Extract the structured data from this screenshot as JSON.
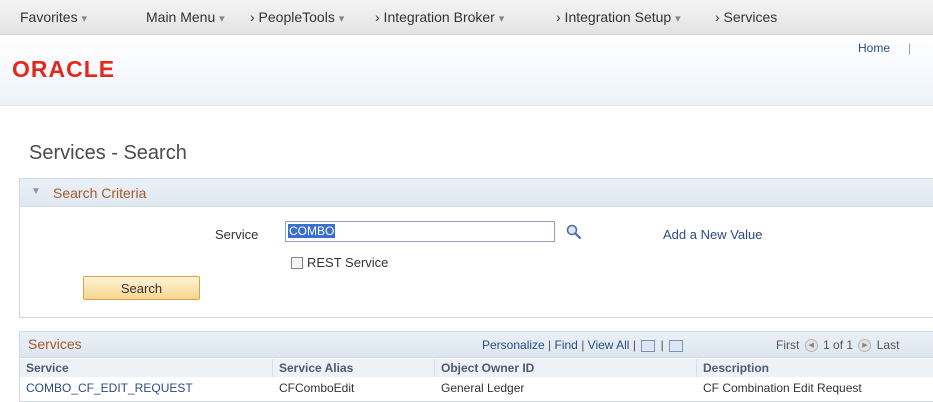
{
  "nav": {
    "items": [
      {
        "label": "Favorites",
        "caret": "▾"
      },
      {
        "label": "Main Menu",
        "caret": "▾"
      },
      {
        "label": "› PeopleTools",
        "caret": "▾"
      },
      {
        "label": "› Integration Broker",
        "caret": "▾"
      },
      {
        "label": "› Integration Setup",
        "caret": "▾"
      },
      {
        "label": "› Services",
        "caret": ""
      }
    ]
  },
  "header": {
    "logo_text": "ORACLE",
    "home_label": "Home",
    "separator": "|"
  },
  "page": {
    "title": "Services - Search"
  },
  "criteria": {
    "section_label": "Search Criteria",
    "service_label": "Service",
    "service_value": "COMBO",
    "add_new_label": "Add a New Value",
    "rest_label": "REST Service",
    "search_button": "Search"
  },
  "grid": {
    "title": "Services",
    "tools": {
      "personalize": "Personalize",
      "find": "Find",
      "view_all": "View All",
      "sep": "|"
    },
    "pager": {
      "first": "First",
      "range": "1 of 1",
      "last": "Last"
    },
    "columns": [
      "Service",
      "Service Alias",
      "Object Owner ID",
      "Description"
    ],
    "rows": [
      [
        "COMBO_CF_EDIT_REQUEST",
        "CFComboEdit",
        "General Ledger",
        "CF Combination Edit Request"
      ]
    ]
  },
  "colors": {
    "accent_red": "#e02a1c",
    "link_blue": "#2a4c80",
    "section_orange": "#a55a28"
  }
}
